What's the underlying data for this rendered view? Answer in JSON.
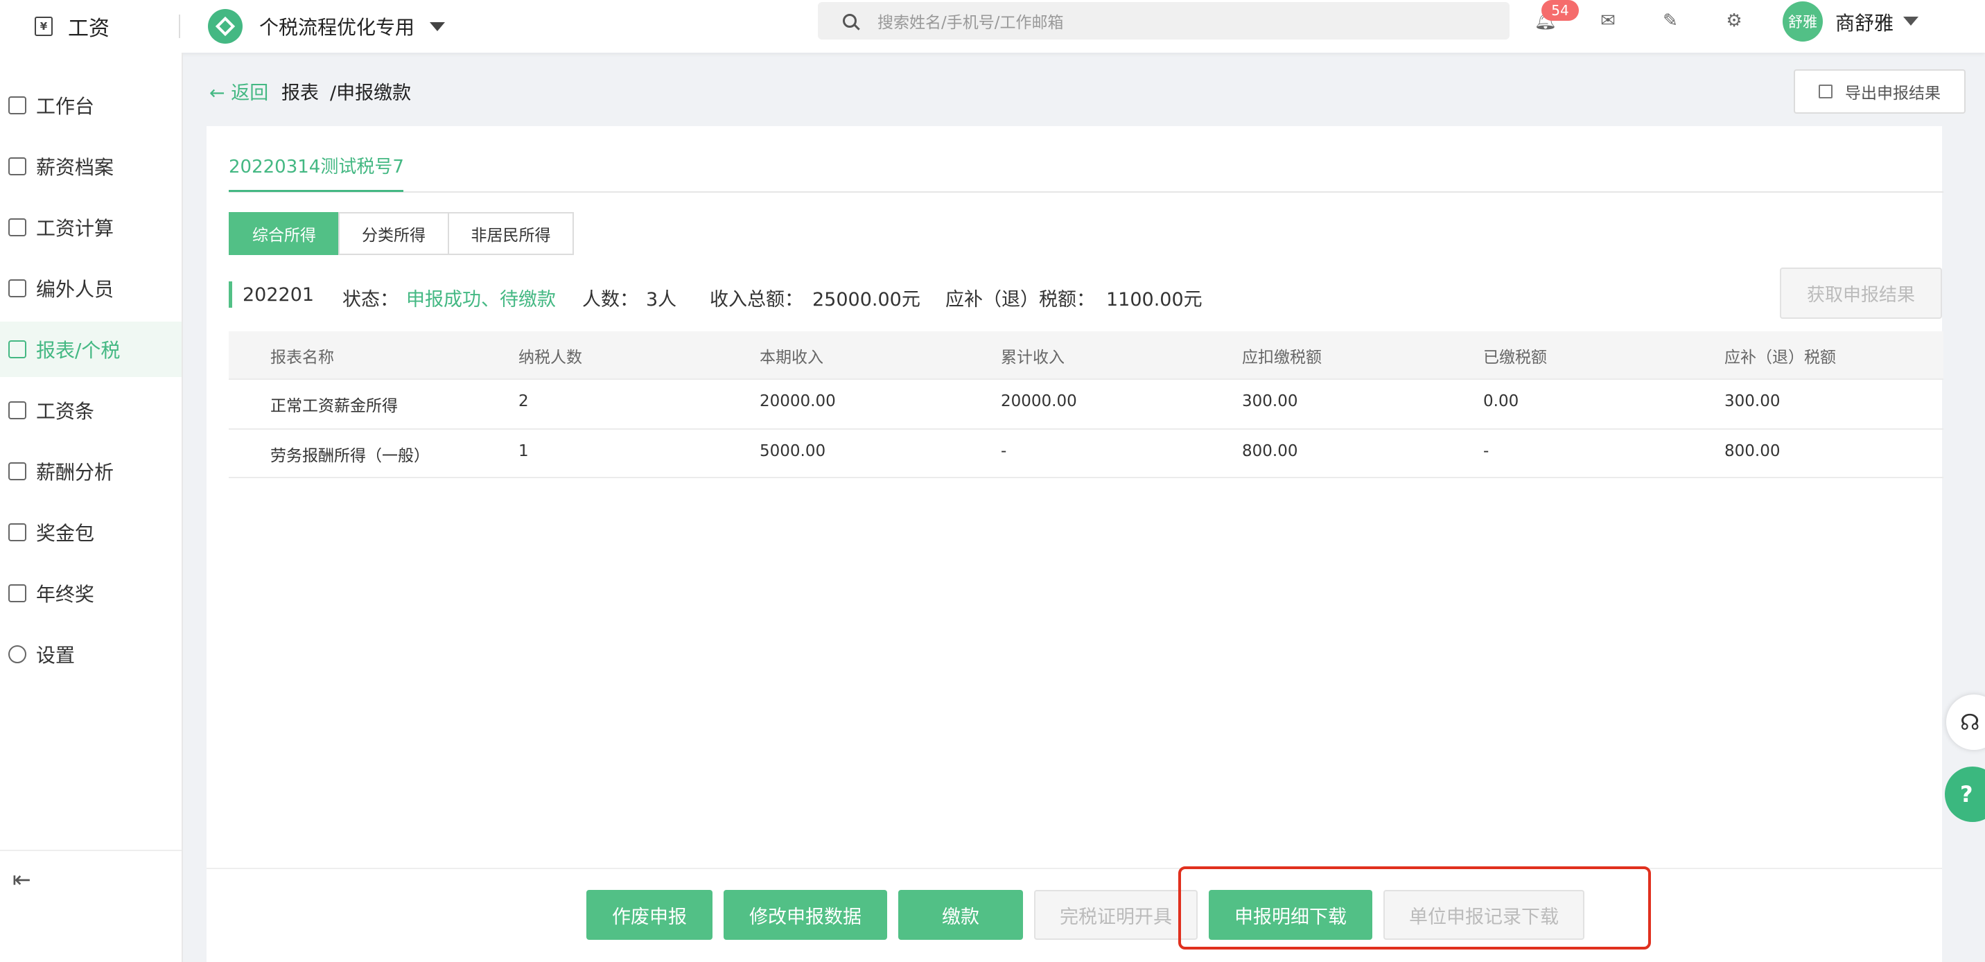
{
  "header": {
    "logo_glyph": "¥",
    "app_title": "工资",
    "company_name": "个税流程优化专用",
    "search_placeholder": "搜索姓名/手机号/工作邮箱",
    "notification_count": "54",
    "avatar_text": "舒雅",
    "user_name": "商舒雅"
  },
  "sidebar": {
    "items": [
      {
        "label": "工作台",
        "icon": "desktop-icon"
      },
      {
        "label": "薪资档案",
        "icon": "profile-icon"
      },
      {
        "label": "工资计算",
        "icon": "calendar-icon"
      },
      {
        "label": "编外人员",
        "icon": "people-icon"
      },
      {
        "label": "报表/个税",
        "icon": "bar-chart-icon",
        "active": true
      },
      {
        "label": "工资条",
        "icon": "document-icon"
      },
      {
        "label": "薪酬分析",
        "icon": "user-search-icon"
      },
      {
        "label": "奖金包",
        "icon": "folder-icon"
      },
      {
        "label": "年终奖",
        "icon": "mail-box-icon"
      },
      {
        "label": "设置",
        "icon": "gear-icon"
      }
    ]
  },
  "breadcrumb": {
    "back": "返回",
    "level1": "报表",
    "level2": "/申报缴款"
  },
  "export_label": "导出申报结果",
  "tab": "20220314测试税号7",
  "segments": [
    "综合所得",
    "分类所得",
    "非居民所得"
  ],
  "summary": {
    "period": "202201",
    "status_label": "状态：",
    "status_value": "申报成功、待缴款",
    "people_label": "人数：",
    "people_value": "3人",
    "income_label": "收入总额：",
    "income_value": "25000.00元",
    "tax_label": "应补（退）税额：",
    "tax_value": "1100.00元"
  },
  "fetch_label": "获取申报结果",
  "table": {
    "columns": [
      "报表名称",
      "纳税人数",
      "本期收入",
      "累计收入",
      "应扣缴税额",
      "已缴税额",
      "应补（退）税额"
    ],
    "rows": [
      [
        "正常工资薪金所得",
        "2",
        "20000.00",
        "20000.00",
        "300.00",
        "0.00",
        "300.00"
      ],
      [
        "劳务报酬所得（一般）",
        "1",
        "5000.00",
        "-",
        "800.00",
        "-",
        "800.00"
      ]
    ]
  },
  "footer_buttons": {
    "void": "作废申报",
    "modify": "修改申报数据",
    "pay": "缴款",
    "certificate": "完税证明开具",
    "detail_download": "申报明细下载",
    "record_download": "单位申报记录下载"
  },
  "colors": {
    "accent": "#52c086",
    "highlight": "#e0301e",
    "badge": "#f56c6c"
  }
}
